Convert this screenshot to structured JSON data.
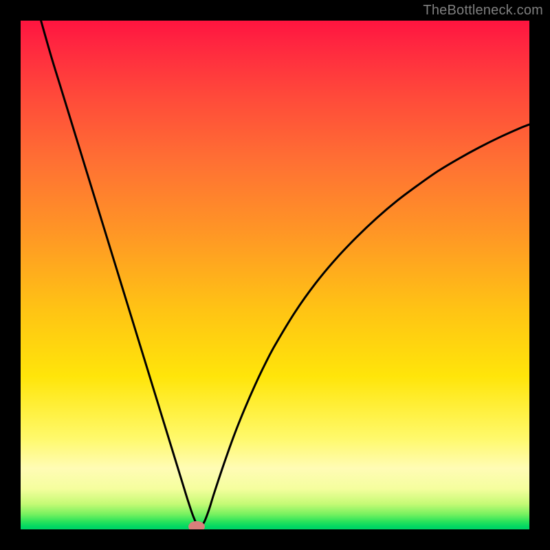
{
  "watermark": "TheBottleneck.com",
  "colors": {
    "frame": "#000000",
    "curve": "#000000",
    "marker": "#d97f7b",
    "watermark": "#7f7f7f"
  },
  "chart_data": {
    "type": "line",
    "title": "",
    "xlabel": "",
    "ylabel": "",
    "xlim": [
      0,
      100
    ],
    "ylim": [
      0,
      100
    ],
    "grid": false,
    "series": [
      {
        "name": "bottleneck-curve",
        "x": [
          4,
          6,
          8,
          10,
          12,
          14,
          16,
          18,
          20,
          22,
          24,
          26,
          28,
          30,
          32,
          33,
          34,
          35,
          36,
          37,
          38,
          40,
          42,
          44,
          46,
          48,
          50,
          54,
          58,
          62,
          66,
          70,
          74,
          78,
          82,
          86,
          90,
          94,
          98,
          100
        ],
        "y": [
          100,
          93,
          86.5,
          80,
          73.5,
          67,
          60.5,
          54,
          47.5,
          41,
          34.5,
          28,
          21.5,
          15,
          8.5,
          5.3,
          2.4,
          0.5,
          1.3,
          3.8,
          7,
          13,
          18.6,
          23.6,
          28.2,
          32.4,
          36.2,
          42.8,
          48.4,
          53.2,
          57.4,
          61.2,
          64.6,
          67.6,
          70.4,
          72.8,
          75,
          77,
          78.8,
          79.6
        ]
      }
    ],
    "marker": {
      "x": 34.6,
      "y": 0.5,
      "rx": 1.6,
      "ry": 1.1
    },
    "background_gradient_stops": [
      {
        "pos": 0.0,
        "color": "#ff143f"
      },
      {
        "pos": 0.15,
        "color": "#ff4a3a"
      },
      {
        "pos": 0.42,
        "color": "#ff9725"
      },
      {
        "pos": 0.7,
        "color": "#ffe50a"
      },
      {
        "pos": 0.88,
        "color": "#fffcb5"
      },
      {
        "pos": 0.97,
        "color": "#78f160"
      },
      {
        "pos": 1.0,
        "color": "#00d366"
      }
    ]
  }
}
